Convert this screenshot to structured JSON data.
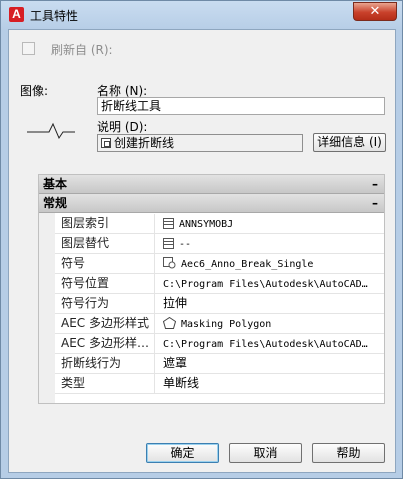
{
  "window": {
    "app_icon_letter": "A",
    "title": "工具特性",
    "close_glyph": "✕"
  },
  "top": {
    "refresh_label": "刷新自 (R):",
    "refresh_checked": false,
    "image_label": "图像:",
    "name_label": "名称 (N):",
    "name_value": "折断线工具",
    "description_label": "说明 (D):",
    "description_value": "创建折断线",
    "details_button": "详细信息 (I)"
  },
  "grid": {
    "categories": [
      {
        "label": "基本",
        "toggle": "–"
      },
      {
        "label": "常规",
        "toggle": "–"
      }
    ],
    "rows": [
      {
        "key": "图层索引",
        "value": "ANNSYMOBJ",
        "icon": "layer-key-icon"
      },
      {
        "key": "图层替代",
        "value": "--",
        "icon": "layer-override-icon"
      },
      {
        "key": "符号",
        "value": "Aec6_Anno_Break_Single",
        "icon": "symbol-icon"
      },
      {
        "key": "符号位置",
        "value": "C:\\Program  Files\\Autodesk\\AutoCAD…",
        "icon": ""
      },
      {
        "key": "符号行为",
        "value": "拉伸",
        "icon": ""
      },
      {
        "key": "AEC 多边形样式",
        "value": "Masking Polygon",
        "icon": "polygon-icon"
      },
      {
        "key": "AEC 多边形样…",
        "value": "C:\\Program  Files\\Autodesk\\AutoCAD…",
        "icon": ""
      },
      {
        "key": "折断线行为",
        "value": "遮罩",
        "icon": ""
      },
      {
        "key": "类型",
        "value": "单断线",
        "icon": ""
      }
    ]
  },
  "buttons": {
    "ok": "确定",
    "cancel": "取消",
    "help": "帮助"
  }
}
